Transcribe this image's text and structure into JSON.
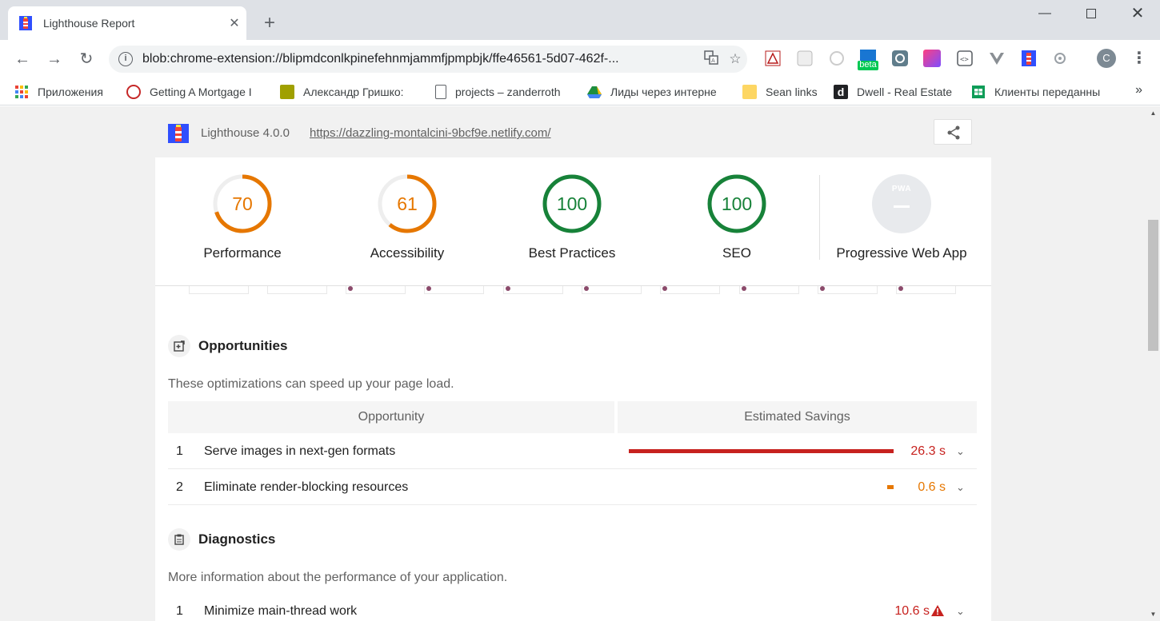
{
  "browser": {
    "tab_title": "Lighthouse Report",
    "url": "blob:chrome-extension://blipmdconlkpinefehnmjammfjpmpbjk/ffe46561-5d07-462f-...",
    "avatar_letter": "C",
    "beta_label": "beta"
  },
  "bookmarks": [
    {
      "label": "Приложения",
      "icon": "apps-grid-icon",
      "color": "#e53935"
    },
    {
      "label": "Getting A Mortgage I",
      "icon": "site-favicon-icon",
      "color": "#c62828"
    },
    {
      "label": "Александр Гришко: ",
      "icon": "home-icon",
      "color": "#8d8d00"
    },
    {
      "label": "projects – zanderroth",
      "icon": "page-icon",
      "color": "#5f6368"
    },
    {
      "label": "Лиды через интерне",
      "icon": "drive-icon",
      "color": "#1e8e3e"
    },
    {
      "label": "Sean links",
      "icon": "folder-icon",
      "color": "#fbc02d"
    },
    {
      "label": "Dwell - Real Estate",
      "icon": "dwell-icon",
      "color": "#202124"
    },
    {
      "label": "Клиенты переданны",
      "icon": "sheets-icon",
      "color": "#0f9d58"
    }
  ],
  "lighthouse": {
    "version": "Lighthouse 4.0.0",
    "url": "https://dazzling-montalcini-9bcf9e.netlify.com/",
    "pwa_badge": "PWA",
    "scores": [
      {
        "label": "Performance",
        "score": "70",
        "fraction": 0.7,
        "color": "#e67700"
      },
      {
        "label": "Accessibility",
        "score": "61",
        "fraction": 0.61,
        "color": "#e67700"
      },
      {
        "label": "Best Practices",
        "score": "100",
        "fraction": 1.0,
        "color": "#178239"
      },
      {
        "label": "SEO",
        "score": "100",
        "fraction": 1.0,
        "color": "#178239"
      }
    ],
    "pwa_label": "Progressive Web App"
  },
  "opportunities": {
    "title": "Opportunities",
    "description": "These optimizations can speed up your page load.",
    "col_opportunity": "Opportunity",
    "col_savings": "Estimated Savings",
    "rows": [
      {
        "index": "1",
        "title": "Serve images in next-gen formats",
        "savings": "26.3 s",
        "fraction": 1.0,
        "color": "#c7221f"
      },
      {
        "index": "2",
        "title": "Eliminate render-blocking resources",
        "savings": "0.6 s",
        "fraction": 0.023,
        "color": "#e67700"
      }
    ]
  },
  "diagnostics": {
    "title": "Diagnostics",
    "description": "More information about the performance of your application.",
    "rows": [
      {
        "index": "1",
        "title": "Minimize main-thread work",
        "value": "10.6 s",
        "color": "#c7221f"
      }
    ]
  }
}
